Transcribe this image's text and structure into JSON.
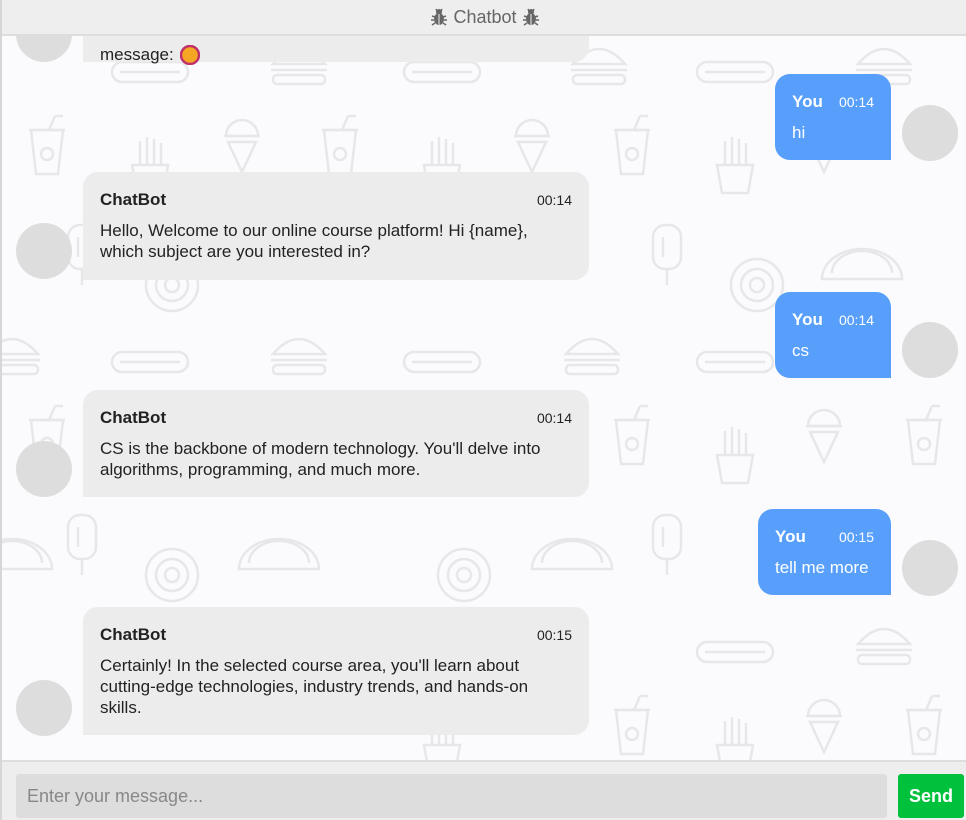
{
  "header": {
    "title": "Chatbot",
    "icon": "bug-icon"
  },
  "partial_message": {
    "text": "message:",
    "emoji": "emoji-icon"
  },
  "messages": [
    {
      "sender": "You",
      "time": "00:14",
      "text": "hi"
    },
    {
      "sender": "ChatBot",
      "time": "00:14",
      "text": "Hello, Welcome to our online course platform! Hi {name}, which subject are you interested in?"
    },
    {
      "sender": "You",
      "time": "00:14",
      "text": "cs"
    },
    {
      "sender": "ChatBot",
      "time": "00:14",
      "text": "CS is the backbone of modern technology. You'll delve into algorithms, programming, and much more."
    },
    {
      "sender": "You",
      "time": "00:15",
      "text": "tell me more"
    },
    {
      "sender": "ChatBot",
      "time": "00:15",
      "text": "Certainly! In the selected course area, you'll learn about cutting-edge technologies, industry trends, and hands-on skills."
    }
  ],
  "input": {
    "placeholder": "Enter your message...",
    "value": ""
  },
  "send": {
    "label": "Send"
  },
  "colors": {
    "user_bubble": "#579ffb",
    "bot_bubble": "#ececec",
    "send_button": "#00c13b",
    "header_bg": "#eeeeee"
  }
}
